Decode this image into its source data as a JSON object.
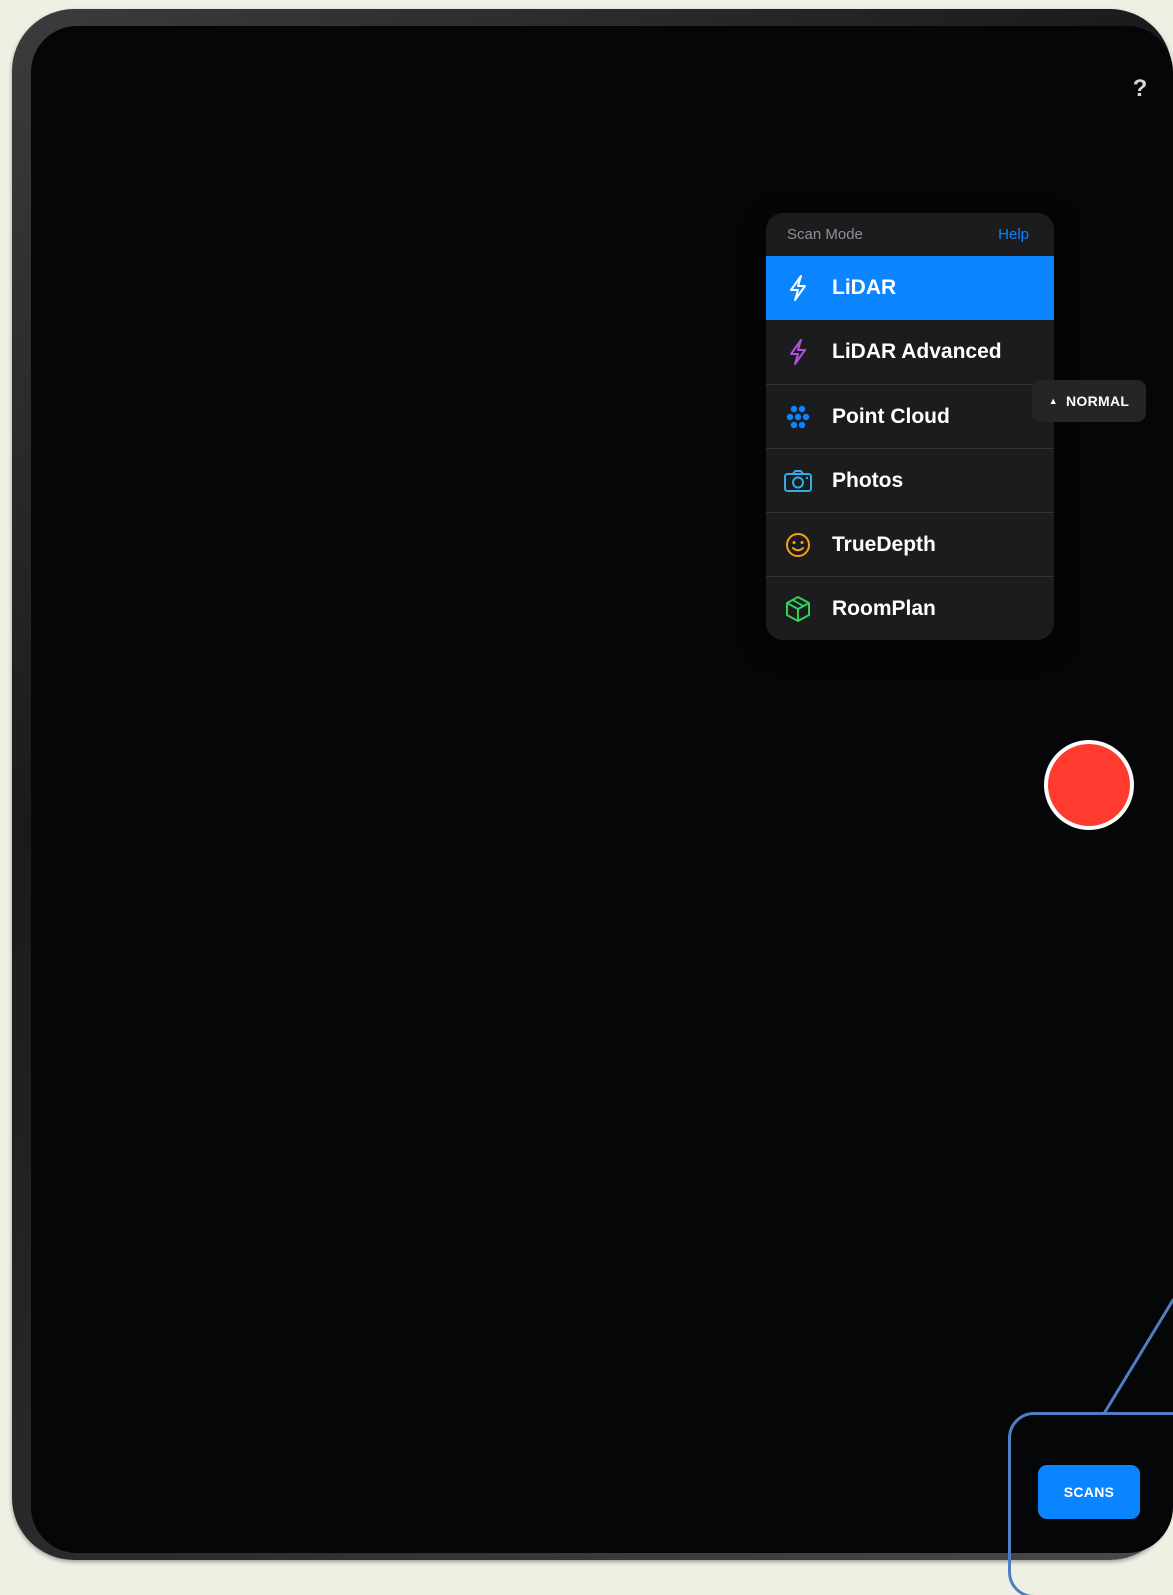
{
  "top_bar": {
    "help_glyph": "?"
  },
  "scan_menu": {
    "title": "Scan Mode",
    "help_link": "Help",
    "items": [
      {
        "label": "LiDAR",
        "icon": "bolt-icon",
        "icon_color": "#ffffff",
        "selected": true
      },
      {
        "label": "LiDAR Advanced",
        "icon": "bolt-icon",
        "icon_color": "#af52de",
        "selected": false
      },
      {
        "label": "Point Cloud",
        "icon": "dots-cluster-icon",
        "icon_color": "#0a84ff",
        "selected": false
      },
      {
        "label": "Photos",
        "icon": "camera-icon",
        "icon_color": "#32ade6",
        "selected": false
      },
      {
        "label": "TrueDepth",
        "icon": "smiley-face-icon",
        "icon_color": "#ff9f0a",
        "selected": false
      },
      {
        "label": "RoomPlan",
        "icon": "cube-icon",
        "icon_color": "#30d158",
        "selected": false
      }
    ]
  },
  "quality_badge": {
    "label": "NORMAL",
    "icon": "triangle-up-icon"
  },
  "record": {
    "icon": "record-icon",
    "color": "#ff3b30"
  },
  "scans_button": {
    "label": "SCANS"
  },
  "accent_color": "#0a84ff",
  "callout_color": "#4f7ec2"
}
